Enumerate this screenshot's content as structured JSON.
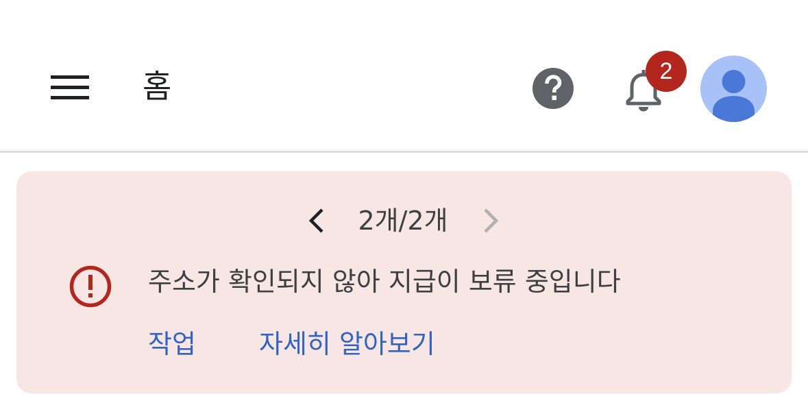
{
  "header": {
    "title": "홈",
    "menu_icon": "hamburger-menu-icon",
    "help_icon": "help-circle-icon",
    "notifications_icon": "bell-icon",
    "notification_count": "2",
    "avatar_icon": "account-avatar-icon"
  },
  "banner": {
    "pager_label": "2개/2개",
    "prev_icon": "chevron-left-icon",
    "next_icon": "chevron-right-icon",
    "alert_icon": "error-circle-icon",
    "message": "주소가 확인되지 않아 지급이 보류 중입니다",
    "action_label": "작업",
    "learn_more_label": "자세히 알아보기"
  },
  "colors": {
    "banner_background": "#f8e6e4",
    "alert_red": "#b3261e",
    "link_blue": "#2f63c4",
    "avatar_background": "#a8c2f7",
    "avatar_figure": "#4a78d8"
  }
}
